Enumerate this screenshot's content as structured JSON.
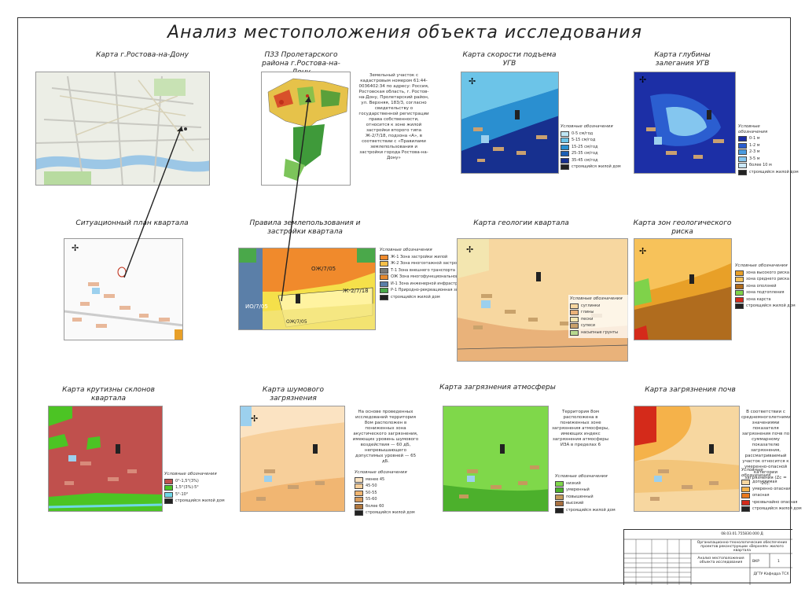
{
  "title": "Анализ местоположения объекта исследования",
  "captions": {
    "city": "Карта г.Ростова-на-Дону",
    "pzz": "ПЗЗ Пролетарского района г.Ростова-на-Дону",
    "ugv_speed": "Карта скорости подъема УГВ",
    "ugv_depth": "Карта глубины залегания УГВ",
    "situation": "Ситуационный план квартала",
    "rules": "Правила землепользования и застройки квартала",
    "geology": "Карта геологии квартала",
    "geo_risk": "Карта зон геологического риска",
    "slopes": "Карта крутизны склонов квартала",
    "noise": "Карта шумового загрязнения",
    "air": "Карта загрязнения атмосферы",
    "soil": "Карта загрязнения почв"
  },
  "notes": {
    "pzz": "Земельный участок с кадастровым номером 61:44-0036402:34 по адресу: Россия, Ростовская область, г. Ростов-на-Дону, Пролетарский район, ул. Верхняя, 183/3, согласно свидетельству о государственной регистрации права собственности, относится к зоне жилой застройки второго типа Ж-2/7/18, подзона «А», в соответствии с «Правилами землепользования и застройки города Ростова-на-Дону»",
    "noise": "На основе проведенных исследований территория 8ом расположен в пониженных зона акустического загрязнения, имеющих уровень шумового воздействия — 60 дБ, непревышающего допустимых уровней — 65 дБ.",
    "air": "Территория 8ом расположена в пониженных зоне загрязнения атмосферы, имеющих индекс загрязнения атмосферы ИЗА в пределах 6",
    "soil": "В соответствии с среднемноголетними значениями показателя загрязнения почв по суммарному показателю загрязнения, рассматриваемый участок относится к умеренно-опасной категории загрязнения (Zc = 20)."
  },
  "zones": {
    "oj": "ОЖ/7/05",
    "io": "ИО/7/05",
    "zh": "Ж-2/7/18",
    "oj2": "ОЖ/7/05"
  },
  "legend_title": "Условные обозначения",
  "legends": {
    "ugv_speed": [
      {
        "label": "0-5 см/год",
        "color": "#bfe6f5"
      },
      {
        "label": "5-15 см/год",
        "color": "#6cc4e8"
      },
      {
        "label": "15-25 см/год",
        "color": "#2a8fd0"
      },
      {
        "label": "25-35 см/год",
        "color": "#1d5fb5"
      },
      {
        "label": "35-45 см/год",
        "color": "#17308f"
      },
      {
        "label": "строящийся жилой дом",
        "color": "#222222"
      }
    ],
    "ugv_depth": [
      {
        "label": "0-1 м",
        "color": "#1c2fa6"
      },
      {
        "label": "1-2 м",
        "color": "#2b5ed0"
      },
      {
        "label": "2-3 м",
        "color": "#4a9be0"
      },
      {
        "label": "3-5 м",
        "color": "#84c6ef"
      },
      {
        "label": "более 10 м",
        "color": "#c9e7f7"
      },
      {
        "label": "строящийся жилой дом",
        "color": "#222222"
      }
    ],
    "rules": [
      {
        "label": "Ж-1 Зона застройки жилой",
        "color": "#f08a2c"
      },
      {
        "label": "Ж-2 Зона многоэтажной застройки",
        "color": "#f5c04a"
      },
      {
        "label": "Т-1 Зона внешнего транспорта",
        "color": "#7a7a7a"
      },
      {
        "label": "ОЖ Зона многофункциональной застройки",
        "color": "#e58a30"
      },
      {
        "label": "И-1 Зона инженерной инфраструктуры",
        "color": "#5b7fa8"
      },
      {
        "label": "Р-1 Природно-рекреационная зона",
        "color": "#4aa84a"
      },
      {
        "label": "строящийся жилой дом",
        "color": "#222222"
      }
    ],
    "geology": [
      {
        "label": "суглинки",
        "color": "#f7d7a0"
      },
      {
        "label": "глины",
        "color": "#e9b27a"
      },
      {
        "label": "пески",
        "color": "#f3e6b0"
      },
      {
        "label": "супеси",
        "color": "#c9a26b"
      },
      {
        "label": "насыпные грунты",
        "color": "#b8d98f"
      }
    ],
    "geo_risk": [
      {
        "label": "зона высокого риска",
        "color": "#e8a028"
      },
      {
        "label": "зона среднего риска",
        "color": "#f7c25a"
      },
      {
        "label": "зона оползней",
        "color": "#b06c1e"
      },
      {
        "label": "зона подтопления",
        "color": "#7fd24a"
      },
      {
        "label": "зона карста",
        "color": "#d42a1a"
      },
      {
        "label": "строящийся жилой дом",
        "color": "#222222"
      }
    ],
    "slopes": [
      {
        "label": "0°-1,5°(3%)",
        "color": "#c0504d"
      },
      {
        "label": "1,5°(3%)-5°",
        "color": "#4cc424"
      },
      {
        "label": "5°-10°",
        "color": "#6fd8e8"
      },
      {
        "label": "строящийся жилой дом",
        "color": "#222222"
      }
    ],
    "noise": [
      {
        "label": "менее 45",
        "color": "#fbe3c2"
      },
      {
        "label": "45-50",
        "color": "#f7cf9a"
      },
      {
        "label": "50-55",
        "color": "#f1b672"
      },
      {
        "label": "55-60",
        "color": "#d89b5c"
      },
      {
        "label": "более 60",
        "color": "#b0773e"
      },
      {
        "label": "строящийся жилой дом",
        "color": "#222222"
      }
    ],
    "air": [
      {
        "label": "низкий",
        "color": "#7fd84a"
      },
      {
        "label": "умеренный",
        "color": "#4cb02c"
      },
      {
        "label": "повышенный",
        "color": "#c49a5c"
      },
      {
        "label": "высокий",
        "color": "#a87040"
      },
      {
        "label": "строящийся жилой дом",
        "color": "#222222"
      }
    ],
    "soil": [
      {
        "label": "допустимая",
        "color": "#f7d7a0"
      },
      {
        "label": "умеренно опасная",
        "color": "#f5b24a"
      },
      {
        "label": "опасная",
        "color": "#e8781e"
      },
      {
        "label": "чрезвычайно опасная",
        "color": "#d42a1a"
      },
      {
        "label": "строящийся жилой дом",
        "color": "#222222"
      }
    ]
  },
  "stamp": {
    "code": "08.03.01.755830.000 Д",
    "desc": "Организационно-технологические обеспечение проектов реконструкции «Верхняя» жилого квартала",
    "sheet_title": "Анализ местоположения объекта исследования",
    "stage": "ВКР",
    "sheet": "1",
    "org": "ДГТУ Кафедра ТСХ"
  }
}
